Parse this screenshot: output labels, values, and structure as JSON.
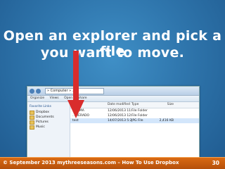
{
  "slide": {
    "title_line1": "Open an explorer and pick a file",
    "title_line2": "you want to move."
  },
  "explorer": {
    "address": "» Computer » ...",
    "toolbar": [
      "Organize",
      "Views",
      "Open",
      "Share"
    ],
    "nav_heading": "Favorite Links",
    "nav_items": [
      "Dropbox",
      "Documents",
      "Pictures",
      "Music"
    ],
    "columns": [
      "Name",
      "Date modified",
      "Type",
      "Size"
    ],
    "rows": [
      {
        "name": "...STMA",
        "date": "12/06/2013 11:54 ...",
        "type": "File Folder",
        "size": ""
      },
      {
        "name": "...MERADO",
        "date": "12/06/2013 12:23 ...",
        "type": "File Folder",
        "size": ""
      },
      {
        "name": "test",
        "date": "14/07/2013 5:20 ...",
        "type": "JPG File",
        "size": "2,416 KB"
      }
    ]
  },
  "footer": {
    "text": "© September 2013 mythreeseasons.com – How To Use Dropbox",
    "page_number": "30"
  },
  "colors": {
    "background": "#2f76ad",
    "footer": "#c85c0f",
    "arrow": "#d92c2c"
  },
  "icons": [
    "folder-icon",
    "arrow-down-icon",
    "back-icon",
    "forward-icon"
  ]
}
